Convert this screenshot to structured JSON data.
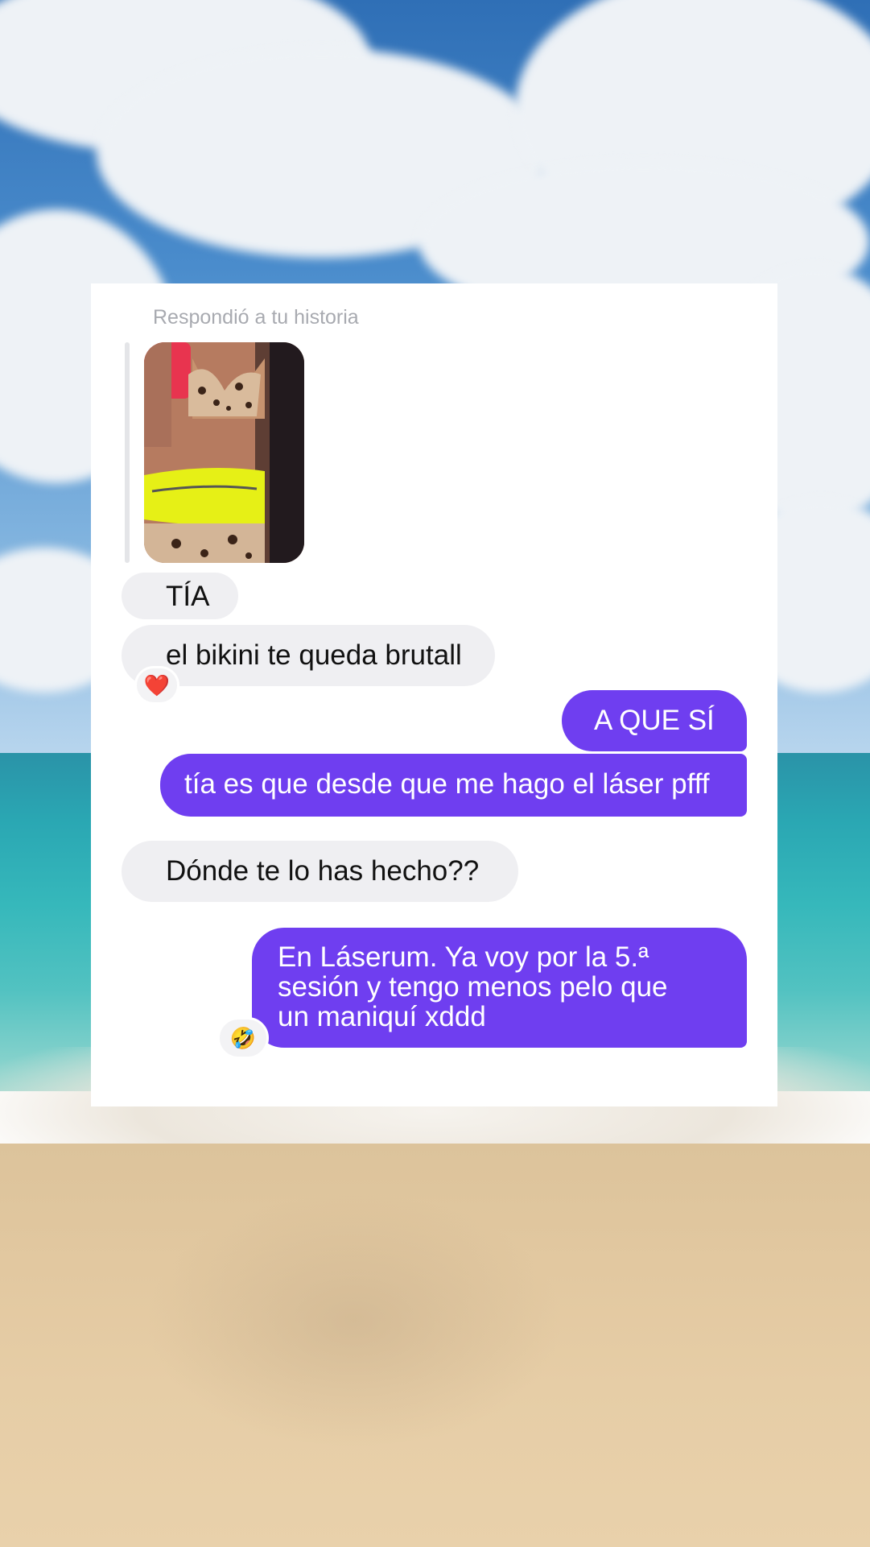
{
  "story_reply": {
    "label": "Respondió a tu historia"
  },
  "messages": [
    {
      "side": "received",
      "text": "TÍA"
    },
    {
      "side": "received",
      "text": "el bikini te queda brutall",
      "reaction": "❤️"
    },
    {
      "side": "sent",
      "text": "A QUE SÍ"
    },
    {
      "side": "sent",
      "text": "tía es que desde que me hago el láser pfff"
    },
    {
      "side": "received",
      "text": "Dónde te lo has hecho??"
    },
    {
      "side": "sent",
      "lines": [
        "En Láserum. Ya voy por la 5.ª",
        "sesión y tengo menos pelo que",
        "un maniquí xddd"
      ],
      "reaction": "🤣"
    }
  ],
  "colors": {
    "sent_bubble": "#6f3ef0",
    "received_bubble": "#efeff2",
    "card_background": "#ffffff"
  }
}
